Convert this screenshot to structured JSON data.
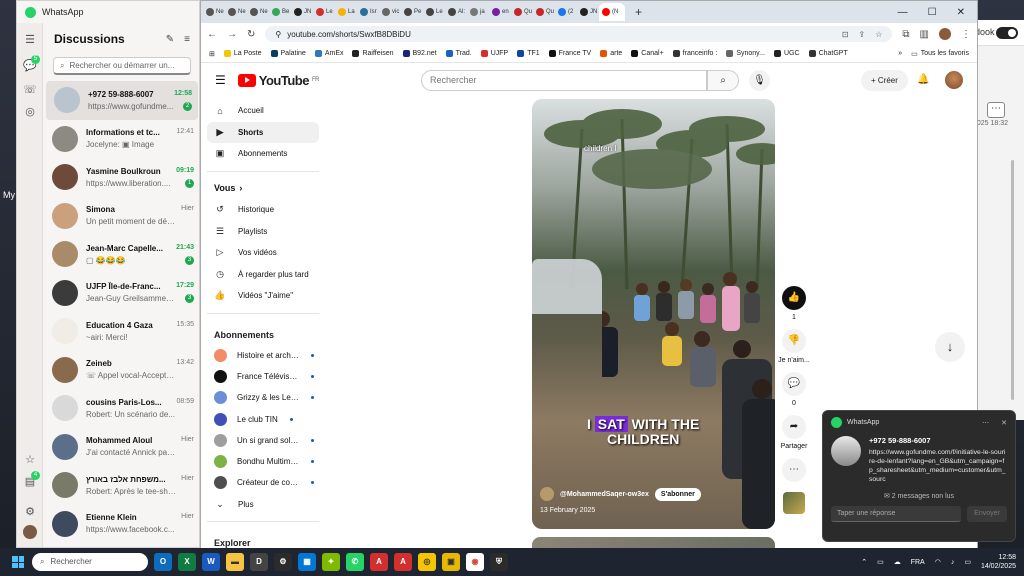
{
  "desktop": {
    "left_label": "My"
  },
  "bg_window": {
    "label": "dook",
    "stamp": "2025 18:32"
  },
  "whatsapp": {
    "title": "WhatsApp",
    "header": "Discussions",
    "search_placeholder": "Rechercher ou démarrer un...",
    "rail_badges": {
      "chats": "5",
      "archive": "4"
    },
    "chats": [
      {
        "name": "+972 59-888-6007",
        "time": "12:58",
        "preview": "https://www.gofundme...",
        "badge": "2",
        "unread": true,
        "color": "#b9c4cf"
      },
      {
        "name": "Informations et tc...",
        "time": "12:41",
        "preview": "Jocelyne: ▣ Image",
        "badge": "",
        "unread": false,
        "color": "#8d8a84"
      },
      {
        "name": "Yasmine Boulkroun",
        "time": "09:19",
        "preview": "https://www.liberation....",
        "badge": "1",
        "unread": true,
        "color": "#6d4a3a"
      },
      {
        "name": "Simona",
        "time": "Hier",
        "preview": "Un petit moment de déc...",
        "badge": "",
        "unread": false,
        "color": "#caa07d"
      },
      {
        "name": "Jean-Marc Capelle...",
        "time": "21:43",
        "preview": "▢ 😂😂😂",
        "badge": "3",
        "unread": true,
        "color": "#a98b6a"
      },
      {
        "name": "UJFP Île-de-Franc...",
        "time": "17:29",
        "preview": "Jean-Guy Greilsammer:...",
        "badge": "3",
        "unread": true,
        "color": "#3b3b3b"
      },
      {
        "name": "Education 4 Gaza",
        "time": "15:35",
        "preview": "~airi: Merci!",
        "badge": "",
        "unread": false,
        "color": "#f1ece6"
      },
      {
        "name": "Zeineb",
        "time": "13:42",
        "preview": "☏ Appel vocal-Accepté...",
        "badge": "",
        "unread": false,
        "color": "#8a6a4c"
      },
      {
        "name": "cousins Paris-Los...",
        "time": "08:59",
        "preview": "Robert: Un scénario de...",
        "badge": "",
        "unread": false,
        "color": "#d9d9d9"
      },
      {
        "name": "Mohammed Aloul",
        "time": "Hier",
        "preview": "J'ai contacté Annick par...",
        "badge": "",
        "unread": false,
        "color": "#5b6f8a"
      },
      {
        "name": "משפחת אלבז באורץ...",
        "time": "Hier",
        "preview": "Robert: Après le tee-shir...",
        "badge": "",
        "unread": false,
        "color": "#7a7a6a"
      },
      {
        "name": "Etienne Klein",
        "time": "Hier",
        "preview": "https://www.facebook.c...",
        "badge": "",
        "unread": false,
        "color": "#3e4a5e"
      }
    ]
  },
  "chrome": {
    "tabs": [
      {
        "label": "Ne",
        "color": "#555"
      },
      {
        "label": "Ne",
        "color": "#555"
      },
      {
        "label": "Ne",
        "color": "#555"
      },
      {
        "label": "Be",
        "color": "#34a853"
      },
      {
        "label": "JN",
        "color": "#222"
      },
      {
        "label": "Le",
        "color": "#d32f2f"
      },
      {
        "label": "La",
        "color": "#f6b400"
      },
      {
        "label": "Isr",
        "color": "#2a6f97"
      },
      {
        "label": "vic",
        "color": "#666"
      },
      {
        "label": "Pe",
        "color": "#444"
      },
      {
        "label": "Le",
        "color": "#444"
      },
      {
        "label": "Al:",
        "color": "#444"
      },
      {
        "label": "ja",
        "color": "#777"
      },
      {
        "label": "en",
        "color": "#7b1fa2"
      },
      {
        "label": "Qu",
        "color": "#c62828"
      },
      {
        "label": "Qu",
        "color": "#c62828"
      },
      {
        "label": "(2",
        "color": "#1877f2"
      },
      {
        "label": "JN",
        "color": "#222"
      },
      {
        "label": "(N",
        "color": "#ff0000"
      }
    ],
    "url": "youtube.com/shorts/SwxfB8DBiDU",
    "bookmarks": [
      {
        "label": "La Poste",
        "color": "#f6c400"
      },
      {
        "label": "Palatine",
        "color": "#0a3d62"
      },
      {
        "label": "AmEx",
        "color": "#2e77bc"
      },
      {
        "label": "Raiffeisen",
        "color": "#222"
      },
      {
        "label": "B92.net",
        "color": "#1a237e"
      },
      {
        "label": "Trad.",
        "color": "#1565c0"
      },
      {
        "label": "UJFP",
        "color": "#d32f2f"
      },
      {
        "label": "TF1",
        "color": "#0d47a1"
      },
      {
        "label": "France TV",
        "color": "#111"
      },
      {
        "label": "arte",
        "color": "#e65100"
      },
      {
        "label": "Canal+",
        "color": "#111"
      },
      {
        "label": "franceinfo :",
        "color": "#333"
      },
      {
        "label": "Synony...",
        "color": "#666"
      },
      {
        "label": "UGC",
        "color": "#222"
      },
      {
        "label": "ChatGPT",
        "color": "#333"
      }
    ],
    "bookmarks_all": "Tous les favoris"
  },
  "youtube": {
    "search_placeholder": "Rechercher",
    "logo_text": "YouTube",
    "logo_sup": "FR",
    "create_label": "Créer",
    "nav": [
      {
        "label": "Accueil",
        "icon": "⌂"
      },
      {
        "label": "Shorts",
        "icon": "▶"
      },
      {
        "label": "Abonnements",
        "icon": "▣"
      }
    ],
    "you_header": "Vous",
    "you_items": [
      {
        "label": "Historique",
        "icon": "↺"
      },
      {
        "label": "Playlists",
        "icon": "☰"
      },
      {
        "label": "Vos vidéos",
        "icon": "▷"
      },
      {
        "label": "À regarder plus tard",
        "icon": "◷"
      },
      {
        "label": "Vidéos \"J'aime\"",
        "icon": "👍"
      }
    ],
    "subs_header": "Abonnements",
    "subscriptions": [
      {
        "label": "Histoire et arché...",
        "color": "#f28b66"
      },
      {
        "label": "France Télévisions",
        "color": "#111"
      },
      {
        "label": "Grizzy & les Lem...",
        "color": "#6a8fd6"
      },
      {
        "label": "Le club TIN",
        "color": "#3f51b5"
      },
      {
        "label": "Un si grand soleil...",
        "color": "#9e9e9e"
      },
      {
        "label": "Bondhu Multime...",
        "color": "#7cb342"
      },
      {
        "label": "Créateur de contrôl...",
        "color": "#4e4e4e"
      }
    ],
    "more_label": "Plus",
    "explore_header": "Explorer",
    "video": {
      "caption_top": "children I",
      "caption_word1": "I",
      "caption_highlight": "SAT",
      "caption_rest": "WITH THE",
      "caption_line2": "CHILDREN",
      "channel": "@MohammedSaqer-ow3ex",
      "subscribe": "S'abonner",
      "date": "13 February 2025"
    },
    "actions": {
      "likes": "1",
      "dislike": "Je n'aim...",
      "comments": "0",
      "share": "Partager"
    }
  },
  "toast": {
    "app": "WhatsApp",
    "title": "+972 59-888-6007",
    "message": "https://www.gofundme.com/f/initiative-le-sourire-de-lenfant?lang=en_GB&utm_campaign=fp_sharesheet&utm_medium=customer&utm_sourc",
    "unread": "2 messages non lus",
    "reply_placeholder": "Taper une réponse",
    "send": "Envoyer"
  },
  "taskbar": {
    "search": "Rechercher",
    "lang": "FRA",
    "time": "12:58",
    "date": "14/02/2025"
  }
}
